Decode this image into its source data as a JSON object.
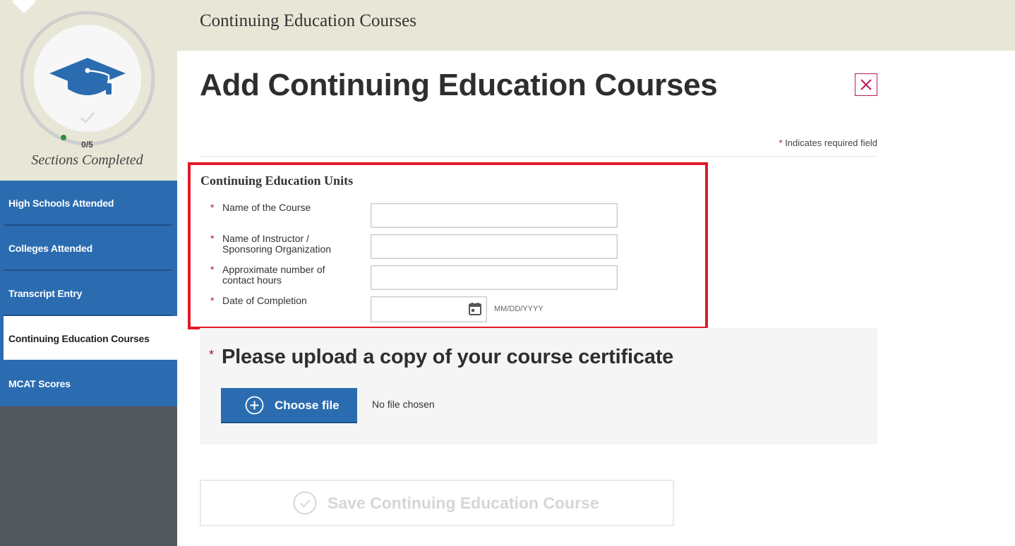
{
  "header": {
    "title": "Continuing Education Courses"
  },
  "progress": {
    "completed": 0,
    "total": 5,
    "count_text": "0/5",
    "label": "Sections Completed"
  },
  "sidebar": {
    "items": [
      {
        "label": "High Schools Attended",
        "active": false
      },
      {
        "label": "Colleges Attended",
        "active": false
      },
      {
        "label": "Transcript Entry",
        "active": false
      },
      {
        "label": "Continuing Education Courses",
        "active": true
      },
      {
        "label": "MCAT Scores",
        "active": false
      }
    ]
  },
  "main": {
    "title": "Add Continuing Education Courses",
    "required_note": "Indicates required field",
    "required_marker": "*",
    "section_title": "Continuing Education Units",
    "fields": {
      "course_name": {
        "label": "Name of the Course",
        "value": ""
      },
      "instructor": {
        "label_line1": "Name of Instructor /",
        "label_line2": "Sponsoring Organization",
        "value": ""
      },
      "contact_hours": {
        "label_line1": "Approximate number of",
        "label_line2": "contact hours",
        "value": ""
      },
      "completion_date": {
        "label": "Date of Completion",
        "value": "",
        "hint": "MM/DD/YYYY"
      }
    },
    "upload": {
      "title": "Please upload a copy of your course certificate",
      "button_label": "Choose file",
      "status": "No file chosen"
    },
    "save_button_label": "Save Continuing Education Course"
  },
  "colors": {
    "nav_blue": "#2b6cb0",
    "nav_blue_dark": "#1e4f85",
    "beige": "#e8e6d6",
    "sidebar_gray": "#52575d",
    "required_star": "#a3153f",
    "highlight_red": "#e2192a",
    "close_magenta": "#c2185b"
  },
  "icons": [
    "graduation-cap-icon",
    "check-icon",
    "close-icon",
    "calendar-icon",
    "plus-circle-icon",
    "check-circle-icon"
  ]
}
